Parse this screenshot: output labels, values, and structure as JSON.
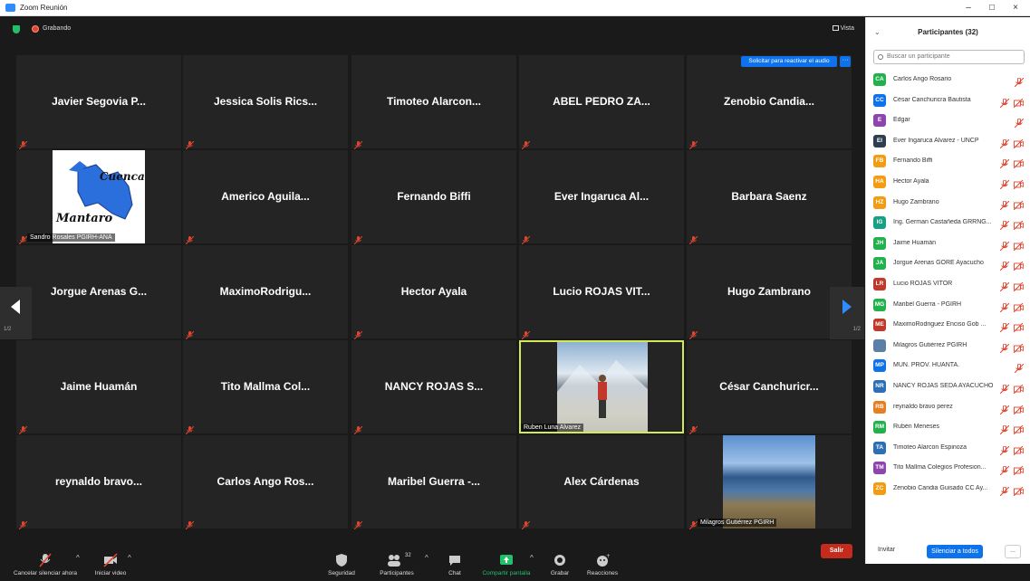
{
  "window": {
    "title": "Zoom Reunión",
    "minimize": "–",
    "maximize": "□",
    "close": "×"
  },
  "topbar": {
    "recording": "Grabando",
    "view": "Vista"
  },
  "unmute_request": {
    "label": "Solicitar para reactivar el audio",
    "more": "···"
  },
  "pager": {
    "left": "1/2",
    "right": "1/2"
  },
  "tiles": [
    "Javier Segovia P...",
    "Jessica Solis Rics...",
    "Timoteo Alarcon...",
    "ABEL PEDRO ZA...",
    "Zenobio Candia...",
    "",
    "Americo Aguila...",
    "Fernando Biffi",
    "Ever Ingaruca Al...",
    "Barbara Saenz",
    "Jorgue Arenas G...",
    "MaximoRodrigu...",
    "Hector Ayala",
    "Lucio ROJAS VIT...",
    "Hugo Zambrano",
    "Jaime Huamán",
    "Tito Mallma Col...",
    "NANCY ROJAS S...",
    "",
    "César Canchuricr...",
    "reynaldo bravo...",
    "Carlos Ango Ros...",
    "Maribel Guerra -...",
    "Alex Cárdenas",
    ""
  ],
  "video_tiles": {
    "sandro": {
      "name": "Sandro Rosales PGIRH-ANA",
      "logo_line1": "Cuenca",
      "logo_line2": "Mantaro"
    },
    "ruben": {
      "name": "Ruben Luna Alvarez"
    },
    "milagros": {
      "name": "Milagros Gutiérrez PGIRH"
    }
  },
  "toolbar": {
    "mute": "Cancelar silenciar ahora",
    "video": "Iniciar video",
    "security": "Seguridad",
    "participants": "Participantes",
    "participants_count": "32",
    "chat": "Chat",
    "share": "Compartir pantalla",
    "record": "Grabar",
    "reactions": "Reacciones",
    "leave": "Salir"
  },
  "panel": {
    "title": "Participantes (32)",
    "search_placeholder": "Buscar un participante",
    "invite": "Invitar",
    "mute_all": "Silenciar a todos",
    "more": "..."
  },
  "participants": [
    {
      "initials": "CA",
      "name": "Carlos Ango Rosario",
      "color": "#23b14d",
      "cam": false
    },
    {
      "initials": "CC",
      "name": "César Canchuricra Bautista",
      "color": "#0e72ed",
      "cam": true
    },
    {
      "initials": "E",
      "name": "Edgar",
      "color": "#8e44ad",
      "cam": false
    },
    {
      "initials": "EI",
      "name": "Ever Ingaruca Alvarez - UNCP",
      "color": "#2c3e50",
      "cam": true
    },
    {
      "initials": "FB",
      "name": "Fernando Biffi",
      "color": "#f39c12",
      "cam": true
    },
    {
      "initials": "HA",
      "name": "Hector Ayala",
      "color": "#f39c12",
      "cam": true
    },
    {
      "initials": "HZ",
      "name": "Hugo Zambrano",
      "color": "#f39c12",
      "cam": true
    },
    {
      "initials": "IG",
      "name": "Ing. German Castañeda GRRNG...",
      "color": "#16a085",
      "cam": true
    },
    {
      "initials": "JH",
      "name": "Jaime Huamán",
      "color": "#23b14d",
      "cam": true
    },
    {
      "initials": "JA",
      "name": "Jorgue Arenas GORE Ayacucho",
      "color": "#23b14d",
      "cam": true
    },
    {
      "initials": "LR",
      "name": "Lucio ROJAS VITOR",
      "color": "#c0392b",
      "cam": true
    },
    {
      "initials": "MG",
      "name": "Maribel Guerra - PGIRH",
      "color": "#23b14d",
      "cam": true
    },
    {
      "initials": "ME",
      "name": "MaximoRodriguez Enciso Gob ...",
      "color": "#c0392b",
      "cam": true
    },
    {
      "initials": "",
      "name": "Milagros Gutiérrez PGIRH",
      "color": "#5b7fa6",
      "cam": true
    },
    {
      "initials": "MP",
      "name": "MUN. PROV. HUANTA.",
      "color": "#0e72ed",
      "cam": false
    },
    {
      "initials": "NR",
      "name": "NANCY ROJAS SEDA AYACUCHO",
      "color": "#2d6fb5",
      "cam": true
    },
    {
      "initials": "RB",
      "name": "reynaldo bravo perez",
      "color": "#e67e22",
      "cam": true
    },
    {
      "initials": "RM",
      "name": "Rubén Meneses",
      "color": "#23b14d",
      "cam": true
    },
    {
      "initials": "TA",
      "name": "Timoteo Alarcon Espinoza",
      "color": "#2d6fb5",
      "cam": true
    },
    {
      "initials": "TM",
      "name": "Tito Mallma Colegios Profesion...",
      "color": "#8e44ad",
      "cam": true
    },
    {
      "initials": "ZC",
      "name": "Zenobio Candia Guisado CC Ay...",
      "color": "#f39c12",
      "cam": true
    }
  ],
  "colors": {
    "accent": "#0e72ed",
    "muted_red": "#e0452f",
    "leave": "#c42b1c",
    "active_speaker": "#d5e855",
    "share_green": "#23c06b"
  }
}
